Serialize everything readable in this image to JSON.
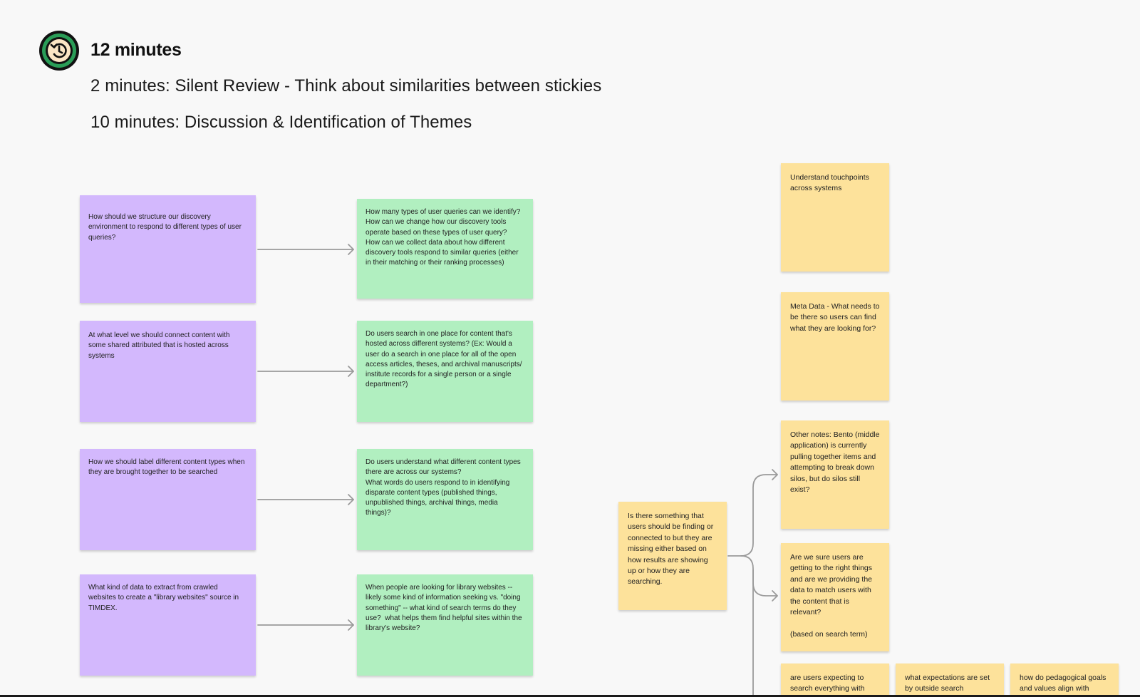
{
  "header": {
    "timer_title": "12 minutes",
    "line1": "2 minutes: Silent Review - Think about similarities between stickies",
    "line2": "10 minutes: Discussion & Identification of Themes"
  },
  "purple_stickies": [
    "How should we structure our discovery environment to respond to different types of user queries?",
    "At what level we should connect content with some shared attributed that is hosted across systems",
    "How we should label different content types when they are brought together to be searched",
    "What kind of data to extract from crawled websites to create a \"library websites\" source in TIMDEX."
  ],
  "green_stickies": [
    "How many types of user queries can we identify?\nHow can we change how our discovery tools operate based on these types of user query?\nHow can we collect data about how different discovery tools respond to similar queries (either in their matching or their ranking processes)",
    "Do users search in one place for content that's hosted across different systems? (Ex: Would a user do a search in one place for all of the open access articles, theses, and archival manuscripts/ institute records for a single person or a single department?)",
    "Do users understand what different content types there are across our systems?\nWhat words do users respond to in identifying disparate content types (published things, unpublished things, archival things, media things)?",
    "When people are looking for library websites -- likely some kind of information seeking vs. \"doing something\" -- what kind of search terms do they use?  what helps them find helpful sites within the library's website?"
  ],
  "yellow_stickies": {
    "touchpoints": "Understand touchpoints across systems",
    "metadata": "Meta Data - What needs to be there so users can find what they are looking for?",
    "other_notes": "Other notes: Bento (middle application) is currently pulling together items and attempting to break down silos, but do silos still exist?",
    "is_there": "Is there something that users should be finding or connected to but they are missing either based on how results are showing up or how they are searching.",
    "are_we_sure": "Are we sure users are getting to the right things and are we providing the data to match users with the content that is relevant?\n\n(based on search term)",
    "bottom1": "are users expecting to search everything with",
    "bottom2": "what expectations are set by outside search",
    "bottom3": "how do pedagogical goals and values align with"
  },
  "colors": {
    "purple": "#d3b8fd",
    "green": "#b1efc0",
    "yellow": "#fde29b",
    "timer_ring": "#2a9d57"
  }
}
